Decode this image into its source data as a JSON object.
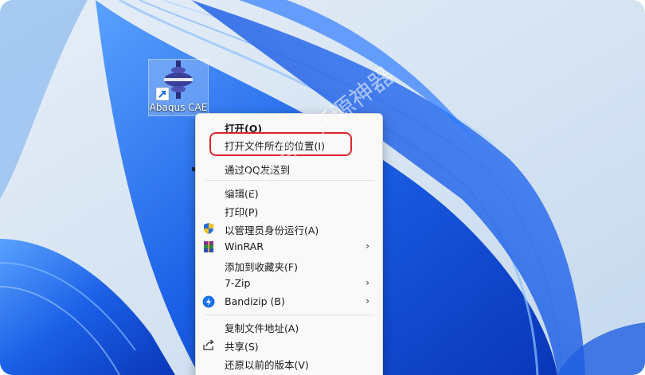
{
  "desktop": {
    "icon_label": "Abaqus CAE",
    "icon_name": "abaqus-app-icon",
    "colors": {
      "wallpaper_light": "#d9e6f3",
      "wallpaper_blue": "#1456e0",
      "highlight": "#e0252b"
    }
  },
  "context_menu": {
    "group1": [
      {
        "label": "打开(O)",
        "icon": "",
        "bold": true
      },
      {
        "label": "打开文件所在的位置(I)",
        "icon": ""
      },
      {
        "label": "通过QQ发送到",
        "icon": ""
      }
    ],
    "group2": [
      {
        "label": "编辑(E)",
        "icon": ""
      },
      {
        "label": "打印(P)",
        "icon": ""
      },
      {
        "label": "以管理员身份运行(A)",
        "icon": "shield-icon"
      },
      {
        "label": "WinRAR",
        "icon": "winrar-icon",
        "submenu": true
      },
      {
        "label": "添加到收藏夹(F)",
        "icon": ""
      },
      {
        "label": "7-Zip",
        "icon": "",
        "submenu": true
      },
      {
        "label": "Bandizip (B)",
        "icon": "bandizip-icon",
        "submenu": true
      }
    ],
    "group3": [
      {
        "label": "复制文件地址(A)",
        "icon": ""
      },
      {
        "label": "共享(S)",
        "icon": "share-icon"
      },
      {
        "label": "还原以前的版本(V)",
        "icon": ""
      }
    ],
    "submenu_arrow": "›"
  },
  "watermark": "©公众号：开源神器"
}
